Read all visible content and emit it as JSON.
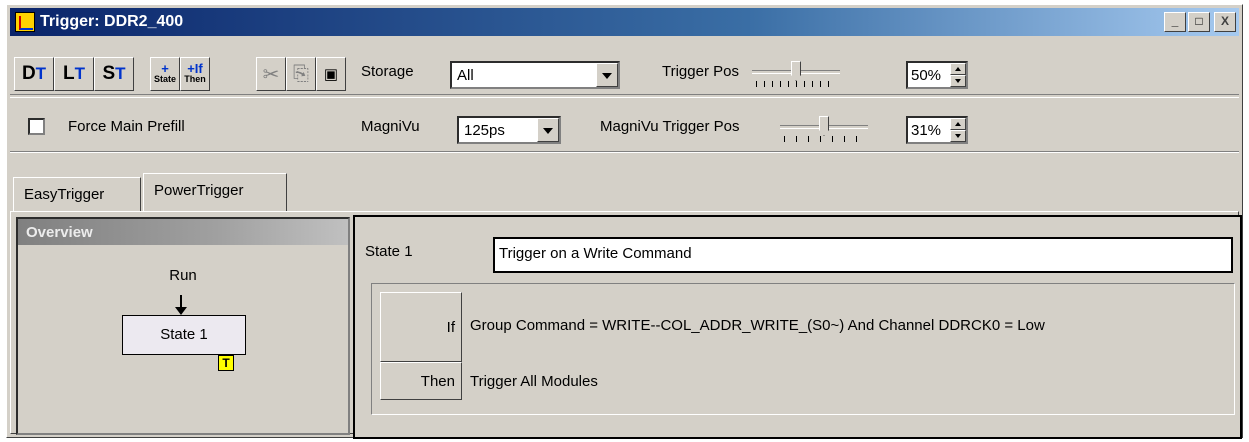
{
  "window": {
    "title": "Trigger: DDR2_400",
    "controls": {
      "minimize": "_",
      "maximize": "□",
      "close": "X"
    }
  },
  "toolbar": {
    "buttons": [
      {
        "name": "data-trigger-button",
        "letter": "D",
        "sub": "T"
      },
      {
        "name": "link-trigger-button",
        "letter": "L",
        "sub": "T"
      },
      {
        "name": "state-trigger-button",
        "letter": "S",
        "sub": "T"
      }
    ],
    "add_state": {
      "plus": "+",
      "label": "State"
    },
    "add_if_then": {
      "plus": "+If",
      "label": "Then"
    },
    "cut_icon": "✂",
    "copy_icon": "⎘",
    "paste_icon": "▣",
    "storage_label": "Storage",
    "storage_value": "All",
    "trigger_pos_label": "Trigger Pos",
    "trigger_pos_value": "50%",
    "trigger_pos_fraction": 0.5
  },
  "row2": {
    "force_main_prefill_label": "Force Main Prefill",
    "force_main_prefill_checked": false,
    "magnivu_label": "MagniVu",
    "magnivu_value": "125ps",
    "magnivu_trigger_pos_label": "MagniVu Trigger Pos",
    "magnivu_trigger_pos_value": "31%",
    "magnivu_trigger_pos_fraction": 0.5
  },
  "tabs": [
    {
      "label": "EasyTrigger",
      "active": false
    },
    {
      "label": "PowerTrigger",
      "active": true
    }
  ],
  "overview": {
    "title": "Overview",
    "run_label": "Run",
    "state_label": "State 1",
    "trigger_marker": "T"
  },
  "detail": {
    "state_label": "State 1",
    "state_description": "Trigger on a Write Command",
    "if_label": "If",
    "if_text": "Group Command = WRITE--COL_ADDR_WRITE_(S0~) And Channel DDRCK0 = Low",
    "then_label": "Then",
    "then_text": "Trigger All Modules"
  },
  "colors": {
    "title_bar": "#0a246a",
    "face": "#d4d0c8",
    "accent_blue": "#0033cc",
    "trigger_marker": "#ffff00"
  }
}
